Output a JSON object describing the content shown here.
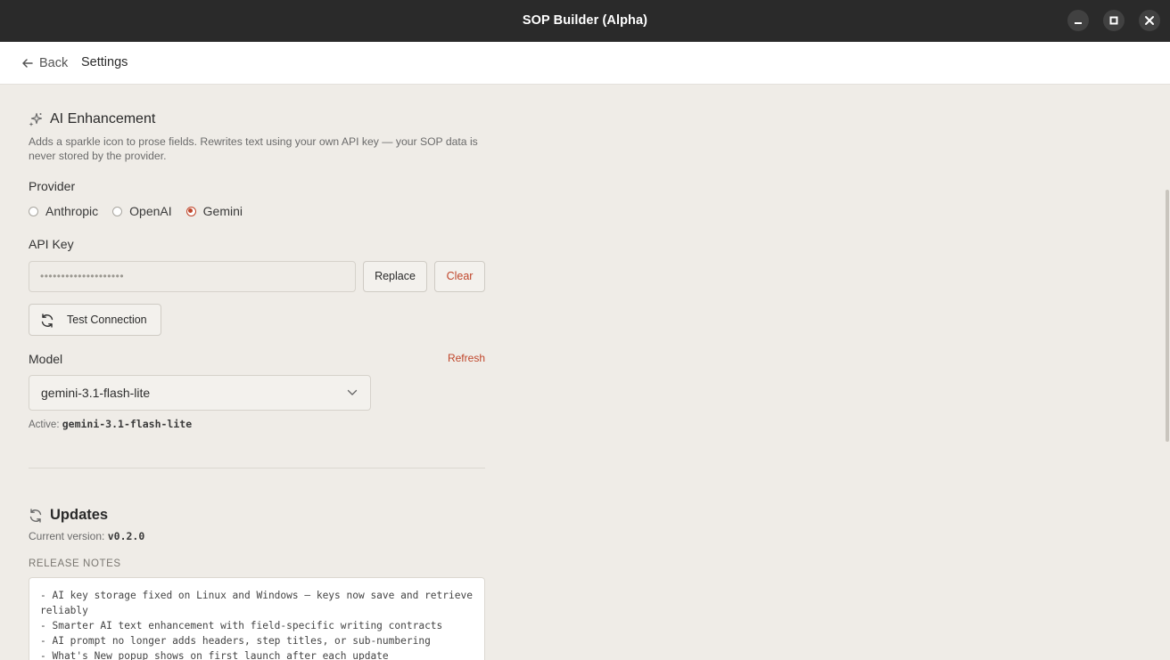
{
  "window": {
    "title": "SOP Builder (Alpha)"
  },
  "header": {
    "back_label": "Back",
    "page_title": "Settings"
  },
  "ai": {
    "title": "AI Enhancement",
    "description": "Adds a sparkle icon to prose fields. Rewrites text using your own API key — your SOP data is never stored by the provider.",
    "provider_label": "Provider",
    "providers": [
      "Anthropic",
      "OpenAI",
      "Gemini"
    ],
    "selected_provider": "Gemini",
    "api_key_label": "API Key",
    "api_key_value": "••••••••••••••••••••",
    "replace_label": "Replace",
    "clear_label": "Clear",
    "test_connection_label": "Test Connection",
    "model_label": "Model",
    "refresh_label": "Refresh",
    "model_value": "gemini-3.1-flash-lite",
    "active_prefix": "Active:",
    "active_model": "gemini-3.1-flash-lite"
  },
  "updates": {
    "title": "Updates",
    "current_version_prefix": "Current version:",
    "current_version": "v0.2.0",
    "release_notes_label": "RELEASE NOTES",
    "release_notes": "- AI key storage fixed on Linux and Windows — keys now save and retrieve reliably\n- Smarter AI text enhancement with field-specific writing contracts\n- AI prompt no longer adds headers, step titles, or sub-numbering\n- What's New popup shows on first launch after each update"
  },
  "colors": {
    "accent": "#c0462b",
    "titlebar": "#2a2a2a",
    "background": "#efece7"
  },
  "icons": {
    "ai": "sparkle-icon",
    "updates": "refresh-icon",
    "back": "arrow-left-icon",
    "test": "refresh-icon",
    "select": "chevron-down-icon"
  }
}
